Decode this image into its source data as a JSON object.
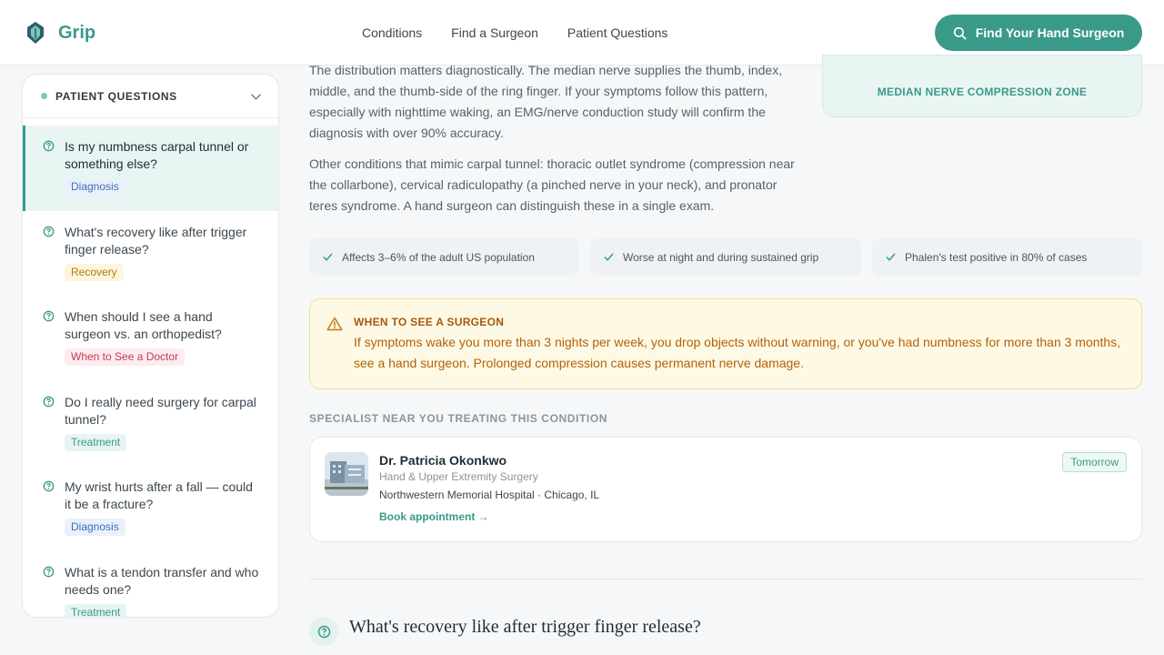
{
  "header": {
    "brand": "Grip",
    "nav": [
      "Conditions",
      "Find a Surgeon",
      "Patient Questions"
    ],
    "cta_label": "Find Your Hand Surgeon"
  },
  "sidebar": {
    "title": "PATIENT QUESTIONS",
    "items": [
      {
        "question": "Is my numbness carpal tunnel or something else?",
        "tag": "Diagnosis"
      },
      {
        "question": "What's recovery like after trigger finger release?",
        "tag": "Recovery"
      },
      {
        "question": "When should I see a hand surgeon vs. an orthopedist?",
        "tag": "When to See a Doctor"
      },
      {
        "question": "Do I really need surgery for carpal tunnel?",
        "tag": "Treatment"
      },
      {
        "question": "My wrist hurts after a fall — could it be a fracture?",
        "tag": "Diagnosis"
      },
      {
        "question": "What is a tendon transfer and who needs one?",
        "tag": "Treatment"
      }
    ]
  },
  "main": {
    "para1": "The distribution matters diagnostically. The median nerve supplies the thumb, index, middle, and the thumb-side of the ring finger. If your symptoms follow this pattern, especially with nighttime waking, an EMG/nerve conduction study will confirm the diagnosis with over 90% accuracy.",
    "para2": "Other conditions that mimic carpal tunnel: thoracic outlet syndrome (compression near the collarbone), cervical radiculopathy (a pinched nerve in your neck), and pronator teres syndrome. A hand surgeon can distinguish these in a single exam.",
    "zone_label": "MEDIAN NERVE COMPRESSION ZONE",
    "stats": [
      "Affects 3–6% of the adult US population",
      "Worse at night and during sustained grip",
      "Phalen's test positive in 80% of cases"
    ],
    "warning": {
      "title": "WHEN TO SEE A SURGEON",
      "text": "If symptoms wake you more than 3 nights per week, you drop objects without warning, or you've had numbness for more than 3 months, see a hand surgeon. Prolonged compression causes permanent nerve damage."
    },
    "specialist": {
      "section_label": "SPECIALIST NEAR YOU TREATING THIS CONDITION",
      "name": "Dr. Patricia Okonkwo",
      "specialty": "Hand & Upper Extremity Surgery",
      "hospital": "Northwestern Memorial Hospital · Chicago, IL",
      "book_label": "Book appointment →",
      "availability": "Tomorrow"
    },
    "next_question": "What's recovery like after trigger finger release?"
  },
  "colors": {
    "accent": "#3a9a8a",
    "warning_bg": "#fef9e4",
    "warning_text": "#b4620a"
  }
}
